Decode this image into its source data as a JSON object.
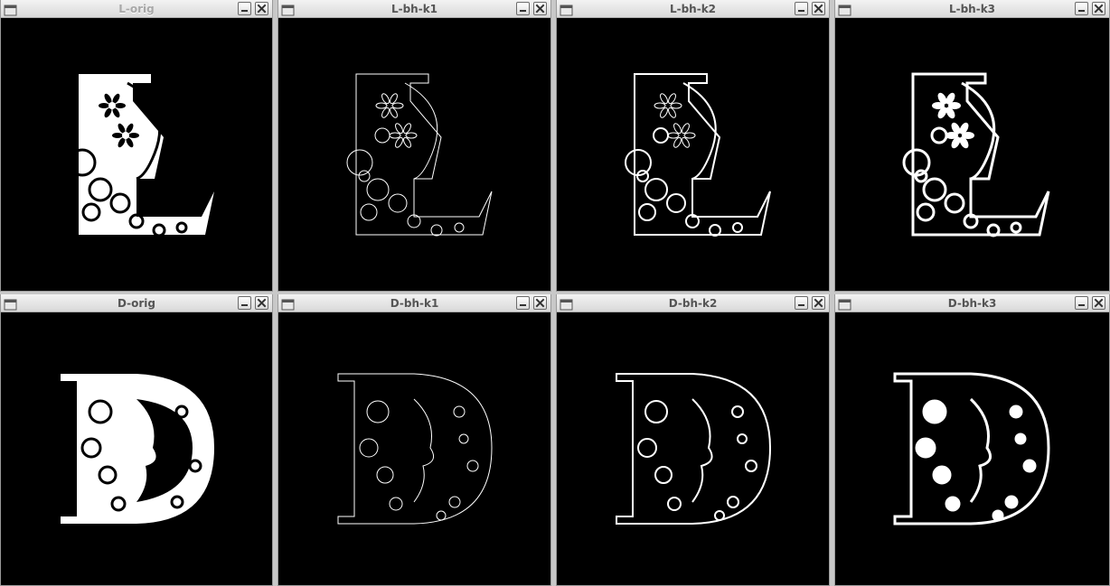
{
  "windows": [
    {
      "id": "l-orig",
      "title": "L-orig",
      "letter": "L",
      "variant": "orig",
      "title_faded": true
    },
    {
      "id": "l-bh-k1",
      "title": "L-bh-k1",
      "letter": "L",
      "variant": "k1",
      "title_faded": false
    },
    {
      "id": "l-bh-k2",
      "title": "L-bh-k2",
      "letter": "L",
      "variant": "k2",
      "title_faded": false
    },
    {
      "id": "l-bh-k3",
      "title": "L-bh-k3",
      "letter": "L",
      "variant": "k3",
      "title_faded": false
    },
    {
      "id": "d-orig",
      "title": "D-orig",
      "letter": "D",
      "variant": "orig",
      "title_faded": false
    },
    {
      "id": "d-bh-k1",
      "title": "D-bh-k1",
      "letter": "D",
      "variant": "k1",
      "title_faded": false
    },
    {
      "id": "d-bh-k2",
      "title": "D-bh-k2",
      "letter": "D",
      "variant": "k2",
      "title_faded": false
    },
    {
      "id": "d-bh-k3",
      "title": "D-bh-k3",
      "letter": "D",
      "variant": "k3",
      "title_faded": false
    }
  ],
  "icons": {
    "window_menu": "window-menu-icon",
    "minimize": "minimize-icon",
    "close": "close-icon"
  },
  "colors": {
    "canvas": "#000000",
    "titlebar": "#e6e6e6",
    "title_text": "#555555",
    "ink": "#ffffff"
  }
}
